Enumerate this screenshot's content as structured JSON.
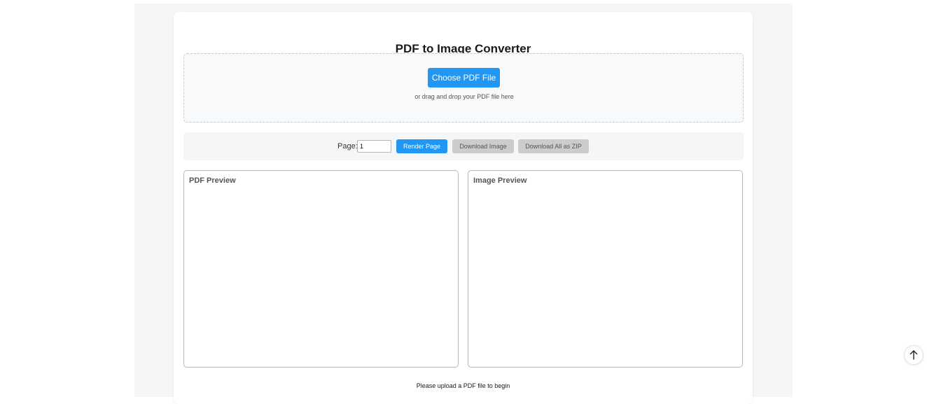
{
  "app": {
    "title": "PDF to Image Converter"
  },
  "upload": {
    "choose_label": "Choose PDF File",
    "drop_hint": "or drag and drop your PDF file here"
  },
  "controls": {
    "page_label": "Page:",
    "page_value": "1",
    "render_label": "Render Page",
    "download_image_label": "Download Image",
    "download_zip_label": "Download All as ZIP"
  },
  "panels": {
    "pdf_preview_title": "PDF Preview",
    "image_preview_title": "Image Preview"
  },
  "status": {
    "text": "Please upload a PDF file to begin"
  },
  "colors": {
    "accent": "#2196f3",
    "disabled": "#cccccc"
  },
  "icons": {
    "scroll_top": "arrow-up-icon"
  }
}
